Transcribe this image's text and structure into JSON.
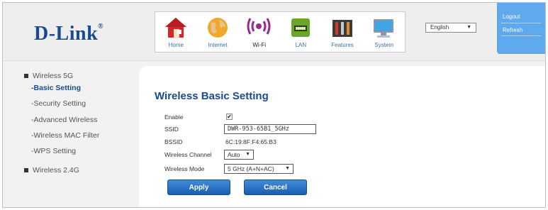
{
  "brand": {
    "logo_text": "D-Link"
  },
  "nav": {
    "items": [
      {
        "label": "Home",
        "icon": "home-icon",
        "active": false
      },
      {
        "label": "Internet",
        "icon": "globe-icon",
        "active": false
      },
      {
        "label": "Wi-Fi",
        "icon": "wifi-icon",
        "active": true
      },
      {
        "label": "LAN",
        "icon": "lan-icon",
        "active": false
      },
      {
        "label": "Features",
        "icon": "tools-icon",
        "active": false
      },
      {
        "label": "System",
        "icon": "monitor-icon",
        "active": false
      }
    ]
  },
  "language": {
    "selected": "English"
  },
  "toplinks": {
    "logout": "Logout",
    "refresh": "Refresh"
  },
  "sidebar": {
    "group_5g": "Wireless 5G",
    "items": [
      {
        "label": "-Basic Setting",
        "active": true
      },
      {
        "label": "-Security Setting",
        "active": false
      },
      {
        "label": "-Advanced Wireless",
        "active": false
      },
      {
        "label": "-Wireless MAC Filter",
        "active": false
      },
      {
        "label": "-WPS Setting",
        "active": false
      }
    ],
    "group_24g": "Wireless 2.4G"
  },
  "main": {
    "title": "Wireless Basic Setting",
    "enable_label": "Enable",
    "enable_checked": true,
    "ssid_label": "SSID",
    "ssid_value": "DWR-953-65B1_5GHz",
    "bssid_label": "BSSID",
    "bssid_value": "6C:19:8F:F4:65:B3",
    "channel_label": "Wireless Channel",
    "channel_value": "Auto",
    "mode_label": "Wireless Mode",
    "mode_value": "5 GHz (A+N+AC)",
    "apply_label": "Apply",
    "cancel_label": "Cancel"
  },
  "colors": {
    "brand_blue": "#1a4a8f",
    "accent_blue": "#5fa9ef",
    "button_blue": "#1a5fae"
  }
}
